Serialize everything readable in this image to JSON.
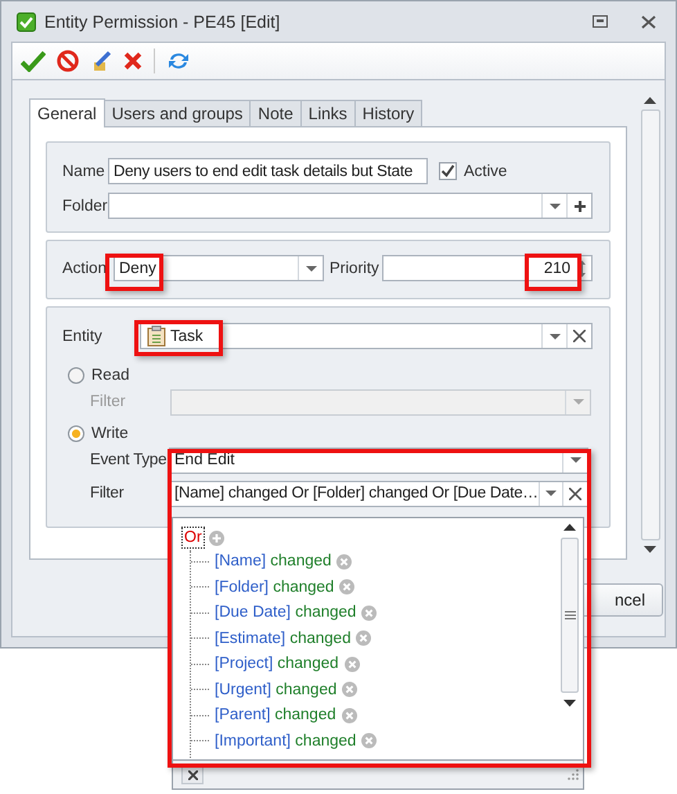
{
  "window": {
    "title": "Entity Permission - PE45 [Edit]"
  },
  "tabs": [
    {
      "label": "General",
      "selected": true
    },
    {
      "label": "Users and groups",
      "selected": false
    },
    {
      "label": "Note",
      "selected": false
    },
    {
      "label": "Links",
      "selected": false
    },
    {
      "label": "History",
      "selected": false
    }
  ],
  "name": {
    "label": "Name",
    "value": "Deny users to end edit task details but State"
  },
  "active": {
    "label": "Active",
    "checked": true
  },
  "folder": {
    "label": "Folder"
  },
  "action": {
    "label": "Action",
    "value": "Deny"
  },
  "priority": {
    "label": "Priority",
    "value": "210"
  },
  "entity": {
    "label": "Entity",
    "value": "Task"
  },
  "read": {
    "label": "Read",
    "selected": false
  },
  "read_filter": {
    "label": "Filter",
    "disabled": true
  },
  "write": {
    "label": "Write",
    "selected": true
  },
  "event_type": {
    "label": "Event Type",
    "value": "End Edit"
  },
  "write_filter": {
    "label": "Filter",
    "value": "[Name] changed  Or [Folder] changed  Or [Due Date…"
  },
  "filter_tree": {
    "operator": "Or",
    "children": [
      {
        "field": "[Name]",
        "op": "changed"
      },
      {
        "field": "[Folder]",
        "op": "changed"
      },
      {
        "field": "[Due Date]",
        "op": "changed"
      },
      {
        "field": "[Estimate]",
        "op": "changed"
      },
      {
        "field": "[Project]",
        "op": "changed"
      },
      {
        "field": "[Urgent]",
        "op": "changed"
      },
      {
        "field": "[Parent]",
        "op": "changed"
      },
      {
        "field": "[Important]",
        "op": "changed"
      }
    ]
  },
  "cancel_button": "ncel"
}
